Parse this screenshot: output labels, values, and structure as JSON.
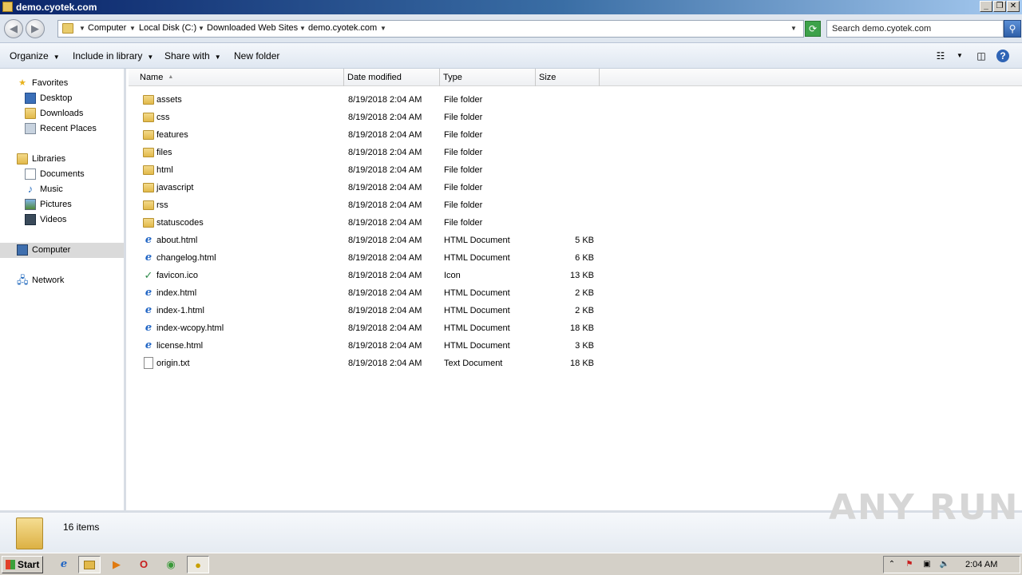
{
  "window": {
    "title": "demo.cyotek.com"
  },
  "address": {
    "crumbs": [
      "Computer",
      "Local Disk (C:)",
      "Downloaded Web Sites",
      "demo.cyotek.com"
    ],
    "search_placeholder": "Search demo.cyotek.com"
  },
  "toolbar": {
    "organize": "Organize",
    "include_in_library": "Include in library",
    "share_with": "Share with",
    "new_folder": "New folder"
  },
  "nav": {
    "favorites": "Favorites",
    "desktop": "Desktop",
    "downloads": "Downloads",
    "recent_places": "Recent Places",
    "libraries": "Libraries",
    "documents": "Documents",
    "music": "Music",
    "pictures": "Pictures",
    "videos": "Videos",
    "computer": "Computer",
    "network": "Network"
  },
  "columns": {
    "name": "Name",
    "date_modified": "Date modified",
    "type": "Type",
    "size": "Size"
  },
  "files": [
    {
      "name": "assets",
      "date": "8/19/2018 2:04 AM",
      "type": "File folder",
      "size": "",
      "icon": "folder-icon"
    },
    {
      "name": "css",
      "date": "8/19/2018 2:04 AM",
      "type": "File folder",
      "size": "",
      "icon": "folder-icon"
    },
    {
      "name": "features",
      "date": "8/19/2018 2:04 AM",
      "type": "File folder",
      "size": "",
      "icon": "folder-icon"
    },
    {
      "name": "files",
      "date": "8/19/2018 2:04 AM",
      "type": "File folder",
      "size": "",
      "icon": "folder-icon"
    },
    {
      "name": "html",
      "date": "8/19/2018 2:04 AM",
      "type": "File folder",
      "size": "",
      "icon": "folder-icon"
    },
    {
      "name": "javascript",
      "date": "8/19/2018 2:04 AM",
      "type": "File folder",
      "size": "",
      "icon": "folder-icon"
    },
    {
      "name": "rss",
      "date": "8/19/2018 2:04 AM",
      "type": "File folder",
      "size": "",
      "icon": "folder-icon"
    },
    {
      "name": "statuscodes",
      "date": "8/19/2018 2:04 AM",
      "type": "File folder",
      "size": "",
      "icon": "folder-icon"
    },
    {
      "name": "about.html",
      "date": "8/19/2018 2:04 AM",
      "type": "HTML Document",
      "size": "5 KB",
      "icon": "html-file-icon"
    },
    {
      "name": "changelog.html",
      "date": "8/19/2018 2:04 AM",
      "type": "HTML Document",
      "size": "6 KB",
      "icon": "html-file-icon"
    },
    {
      "name": "favicon.ico",
      "date": "8/19/2018 2:04 AM",
      "type": "Icon",
      "size": "13 KB",
      "icon": "ico-file-icon"
    },
    {
      "name": "index.html",
      "date": "8/19/2018 2:04 AM",
      "type": "HTML Document",
      "size": "2 KB",
      "icon": "html-file-icon"
    },
    {
      "name": "index-1.html",
      "date": "8/19/2018 2:04 AM",
      "type": "HTML Document",
      "size": "2 KB",
      "icon": "html-file-icon"
    },
    {
      "name": "index-wcopy.html",
      "date": "8/19/2018 2:04 AM",
      "type": "HTML Document",
      "size": "18 KB",
      "icon": "html-file-icon"
    },
    {
      "name": "license.html",
      "date": "8/19/2018 2:04 AM",
      "type": "HTML Document",
      "size": "3 KB",
      "icon": "html-file-icon"
    },
    {
      "name": "origin.txt",
      "date": "8/19/2018 2:04 AM",
      "type": "Text Document",
      "size": "18 KB",
      "icon": "text-file-icon"
    }
  ],
  "status": {
    "item_count": "16 items"
  },
  "watermark": "ANY RUN",
  "taskbar": {
    "start": "Start",
    "clock": "2:04 AM"
  },
  "colors": {
    "title_gradient_start": "#0a246a",
    "taskbar": "#d4d0c8",
    "selection": "#dadada"
  }
}
